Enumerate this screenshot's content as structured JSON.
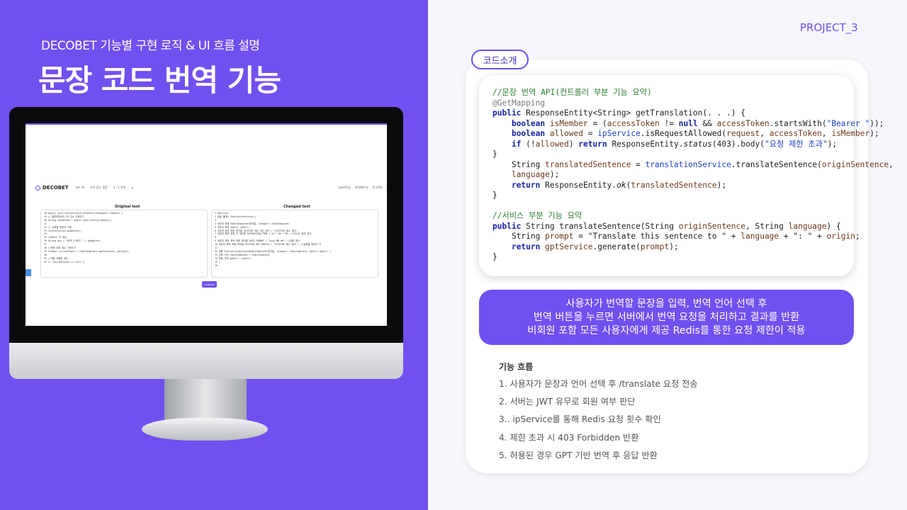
{
  "header": {
    "subtitle": "DECOBET 기능별 구현 로직 & UI 흐름 설명",
    "title": "문장 코드 번역 기능",
    "project_label": "PROJECT_3"
  },
  "screen": {
    "logo": "DECOBET",
    "nav_items": [
      "코드 AI",
      "자주 묻는 질문",
      "1 : 1 문의"
    ],
    "nav_right": [
      "user01님",
      "마이페이지",
      "로그아웃"
    ],
    "original_title": "Original text",
    "changed_title": "Changed text",
    "compare_button": "COMPARE",
    "original_lines": [
      "18     public void recordVisitor(HttpServletRequest request) {",
      "19         // 클라이언트의 IP 주소 가져오기",
      "20         String ipAddress = ipUtil.getClientIp(request);",
      "21",
      "22         // 날짜별 방문자 기록",
      "23         recordVisitor(ipAddress);",
      "24",
      "25         //Redis 키 생성",
      "26         String key = \"RATE_LIMIT:\" + ipAddress;",
      "27",
      "28         //현재 요청 횟수 가져오기",
      "29         Integer currentCount = redisTemplate.opsForValue().get(key);",
      "30",
      "31         //처음 요청한 경우",
      "32         if (currentCount == null) {"
    ],
    "changed_lines": [
      "1  @Service",
      "2  공용 클래스 StatisticsService {",
      "3",
      "4    비공개 최종 RedisTemplate<문자열, Integer> redisTemplate;",
      "5    비공개 최종 IpUtil ipUtil;",
      "6    비공개 정적 최종 문자열 VISITOR_계수 계산_KEY = \"VISITOR_계수 계산\";",
      "7    비공개 정적 최종 긴 접속원 EXPIRATION_TIME = 24 * 60 * 60; //24시간 동안 유지",
      "8",
      "9    비공개 최종 정적 최종 문자열 DATE_FORMAT = \"yyyy-MM-dd\"; //날짜 형식",
      "10   비공개 정적 최종 문자열 VISITOR_KEY_PREFIX = \"VISITOR_계수 계산:\"; //날짜별 방문자 키",
      "11",
      "12   공용 StatisticsService(RedisTemplate<문자열, Integer> redisTemplate, IpUtil ipUtil) {",
      "13       현재 가득.redisTemplate = redisTemplate;",
      "14       현재 가득.ipUtil = ipUtil;",
      "15   }",
      "16"
    ]
  },
  "code_section": {
    "label": "코드소개"
  },
  "description": {
    "lines": [
      "사용자가 번역할 문장을 입력, 번역 언어 선택 후",
      "번역 버튼을 누르면 서버에서 번역 요청을 처리하고 결과를 반환",
      "비회원 포함 모든 사용자에게 제공 Redis를 통한 요청 제한이 적용"
    ]
  },
  "flow": {
    "title": "기능 흐름",
    "steps": [
      "1. 사용자가 문장과 언어 선택 후 /translate 요청 전송",
      "2. 서버는 JWT 유무로 회원 여부 판단",
      "3.. ipService를 통해 Redis 요청 횟수 확인",
      "4. 제한 초과 시 403 Forbidden 반환",
      "5. 허용된 경우 GPT 기반 번역 후 응답 반환"
    ]
  },
  "colors": {
    "primary": "#7150f0",
    "background": "#f6f6fb"
  }
}
